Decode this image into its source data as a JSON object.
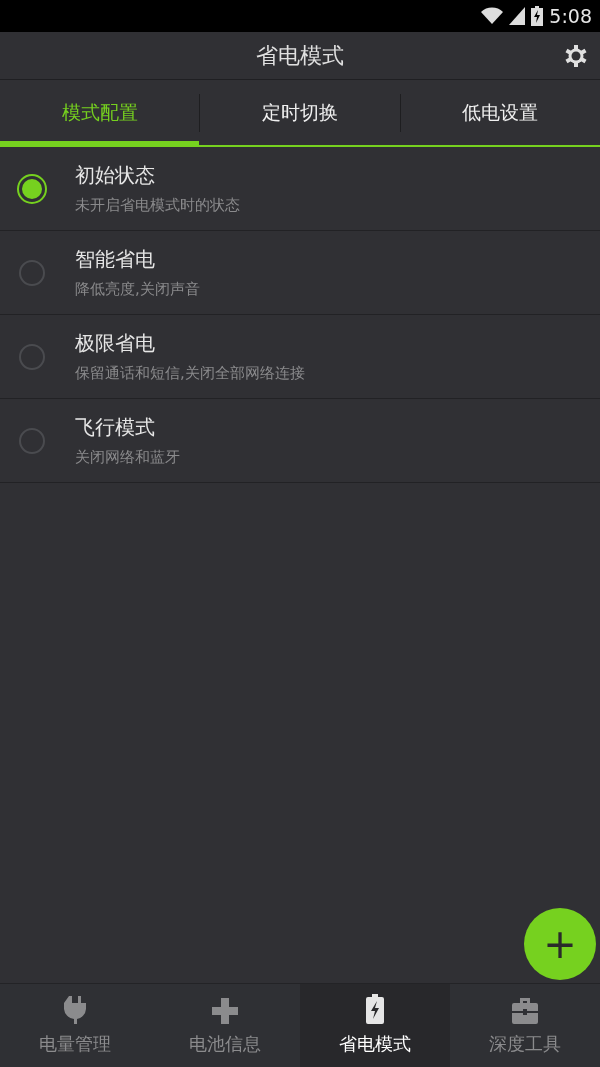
{
  "status_bar": {
    "time": "5:08"
  },
  "header": {
    "title": "省电模式"
  },
  "tabs": [
    {
      "label": "模式配置",
      "selected": true
    },
    {
      "label": "定时切换",
      "selected": false
    },
    {
      "label": "低电设置",
      "selected": false
    }
  ],
  "modes": [
    {
      "title": "初始状态",
      "subtitle": "未开启省电模式时的状态",
      "selected": true
    },
    {
      "title": "智能省电",
      "subtitle": "降低亮度,关闭声音",
      "selected": false
    },
    {
      "title": "极限省电",
      "subtitle": "保留通话和短信,关闭全部网络连接",
      "selected": false
    },
    {
      "title": "飞行模式",
      "subtitle": "关闭网络和蓝牙",
      "selected": false
    }
  ],
  "fab": {
    "label": "+"
  },
  "bottom_nav": [
    {
      "label": "电量管理",
      "selected": false
    },
    {
      "label": "电池信息",
      "selected": false
    },
    {
      "label": "省电模式",
      "selected": true
    },
    {
      "label": "深度工具",
      "selected": false
    }
  ]
}
